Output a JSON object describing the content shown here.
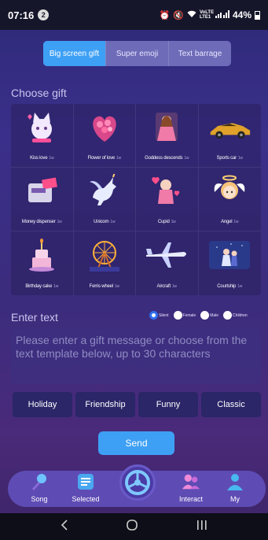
{
  "status_bar": {
    "time": "07:16",
    "notification_count": "2",
    "network": "VoLTE LTE1",
    "battery": "44%"
  },
  "tabs": [
    {
      "label": "Big screen gift",
      "active": true
    },
    {
      "label": "Super emoji",
      "active": false
    },
    {
      "label": "Text barrage",
      "active": false
    }
  ],
  "choose_gift_label": "Choose gift",
  "gifts": [
    {
      "name": "Kiss love",
      "price": "1w",
      "icon": "cat-icon"
    },
    {
      "name": "Flower of love",
      "price": "1w",
      "icon": "flower-icon"
    },
    {
      "name": "Goddess descends",
      "price": "1w",
      "icon": "goddess-icon"
    },
    {
      "name": "Sports car",
      "price": "1w",
      "icon": "car-icon"
    },
    {
      "name": "Money dispenser",
      "price": "1w",
      "icon": "money-icon"
    },
    {
      "name": "Unicorn",
      "price": "1w",
      "icon": "unicorn-icon"
    },
    {
      "name": "Cupid",
      "price": "1w",
      "icon": "cupid-icon"
    },
    {
      "name": "Angel",
      "price": "1w",
      "icon": "angel-icon"
    },
    {
      "name": "Birthday cake",
      "price": "1w",
      "icon": "cake-icon"
    },
    {
      "name": "Ferris wheel",
      "price": "1w",
      "icon": "ferris-wheel-icon"
    },
    {
      "name": "Aircraft",
      "price": "1w",
      "icon": "aircraft-icon"
    },
    {
      "name": "Courtship",
      "price": "1w",
      "icon": "courtship-icon"
    }
  ],
  "enter_text_label": "Enter text",
  "voice_options": [
    {
      "label": "Silent",
      "checked": true
    },
    {
      "label": "Female",
      "checked": false
    },
    {
      "label": "Male",
      "checked": false
    },
    {
      "label": "Children",
      "checked": false
    }
  ],
  "message_placeholder": "Please enter a gift message or choose from the text template below, up to 30 characters",
  "templates": [
    "Holiday",
    "Friendship",
    "Funny",
    "Classic"
  ],
  "send_label": "Send",
  "bottom_nav": [
    {
      "label": "Song",
      "icon": "microphone-icon"
    },
    {
      "label": "Selected",
      "icon": "playlist-icon"
    },
    {
      "label": "Interact",
      "icon": "people-icon"
    },
    {
      "label": "My",
      "icon": "user-icon"
    }
  ],
  "colors": {
    "accent": "#3ea0f5",
    "tab_bg": "#6e6bb8",
    "nav_bg": "#5e4cb4"
  }
}
